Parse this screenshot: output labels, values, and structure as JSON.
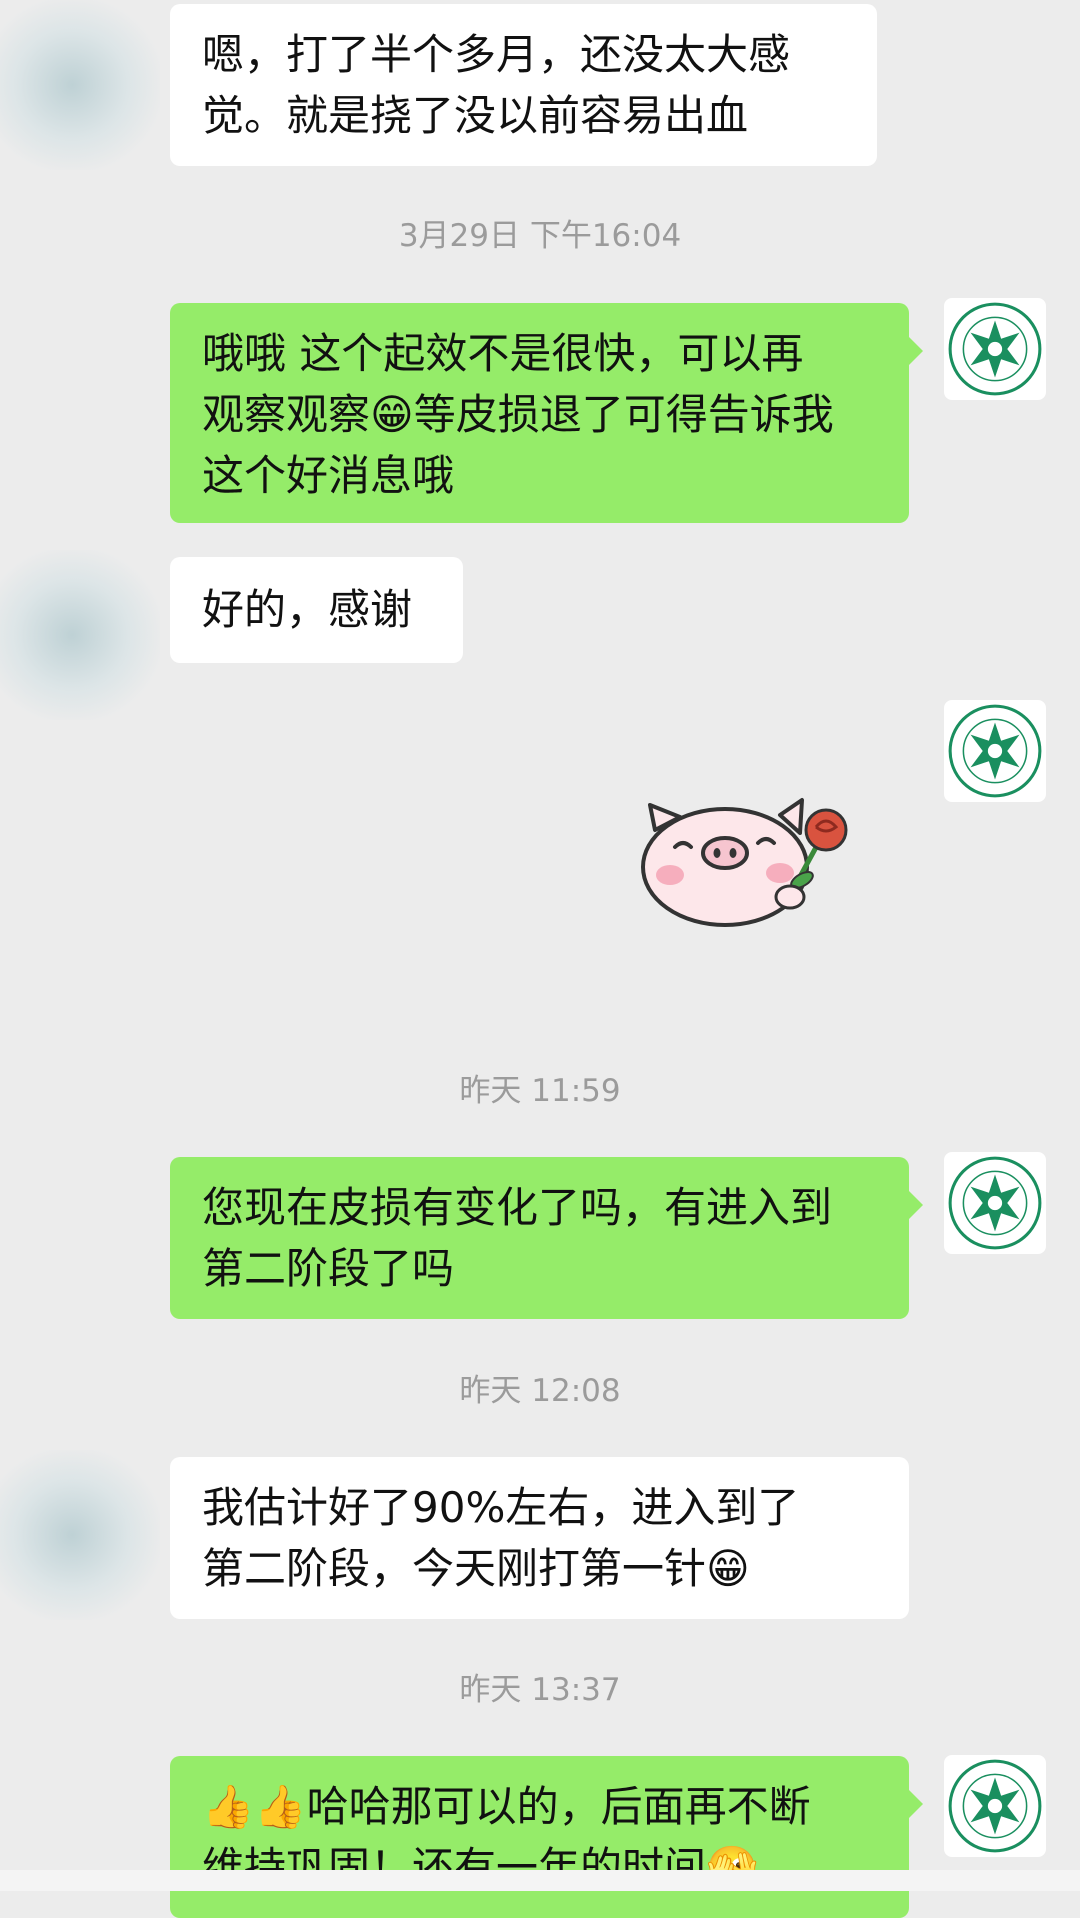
{
  "messages": [
    {
      "type": "incoming",
      "text": "嗯，打了半个多月，还没太大感\n觉。就是挠了没以前容易出血"
    },
    {
      "type": "timestamp",
      "text": "3月29日 下午16:04"
    },
    {
      "type": "outgoing",
      "text": "哦哦 这个起效不是很快，可以再\n观察观察😁等皮损退了可得告诉我\n这个好消息哦"
    },
    {
      "type": "incoming",
      "text": "好的，感谢"
    },
    {
      "type": "outgoing_sticker",
      "sticker": "pig-holding-rose-sticker"
    },
    {
      "type": "timestamp",
      "text": "昨天 11:59"
    },
    {
      "type": "outgoing",
      "text": "您现在皮损有变化了吗，有进入到\n第二阶段了吗"
    },
    {
      "type": "timestamp",
      "text": "昨天 12:08"
    },
    {
      "type": "incoming",
      "text": "我估计好了90%左右，进入到了\n第二阶段，今天刚打第一针😁"
    },
    {
      "type": "timestamp",
      "text": "昨天 13:37"
    },
    {
      "type": "outgoing",
      "text": "👍👍哈哈那可以的，后面再不断\n维持巩固！还有一年的时间🫣"
    }
  ],
  "colors": {
    "background": "#ececec",
    "outgoing_bubble": "#95ec69",
    "incoming_bubble": "#ffffff",
    "timestamp_text": "#9b9b9b",
    "avatar_logo": "#1a8f5f"
  },
  "icons": {
    "sender_avatar": "blurred-avatar",
    "self_avatar": "green-star-seal-logo"
  }
}
